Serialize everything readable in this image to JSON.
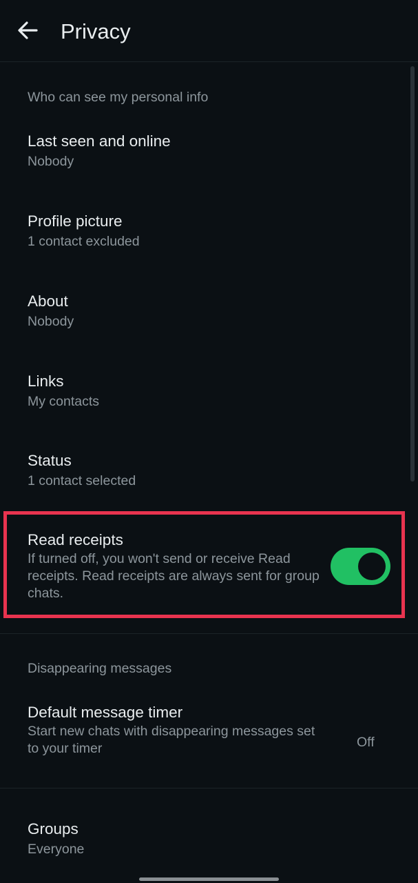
{
  "header": {
    "title": "Privacy",
    "back_icon": "arrow-left-icon"
  },
  "personal_info": {
    "section_label": "Who can see my personal info",
    "items": [
      {
        "title": "Last seen and online",
        "value": "Nobody"
      },
      {
        "title": "Profile picture",
        "value": "1 contact excluded"
      },
      {
        "title": "About",
        "value": "Nobody"
      },
      {
        "title": "Links",
        "value": "My contacts"
      },
      {
        "title": "Status",
        "value": "1 contact selected"
      }
    ]
  },
  "read_receipts": {
    "title": "Read receipts",
    "description": "If turned off, you won't send or receive Read receipts. Read receipts are always sent for group chats.",
    "enabled": true
  },
  "disappearing": {
    "section_label": "Disappearing messages",
    "timer_title": "Default message timer",
    "timer_description": "Start new chats with disappearing messages set to your timer",
    "timer_value": "Off"
  },
  "groups": {
    "title": "Groups",
    "value": "Everyone"
  },
  "colors": {
    "background": "#0b1014",
    "primary_text": "#e9edef",
    "secondary_text": "#8d969c",
    "toggle_on": "#21c063",
    "highlight": "#e8334f"
  }
}
